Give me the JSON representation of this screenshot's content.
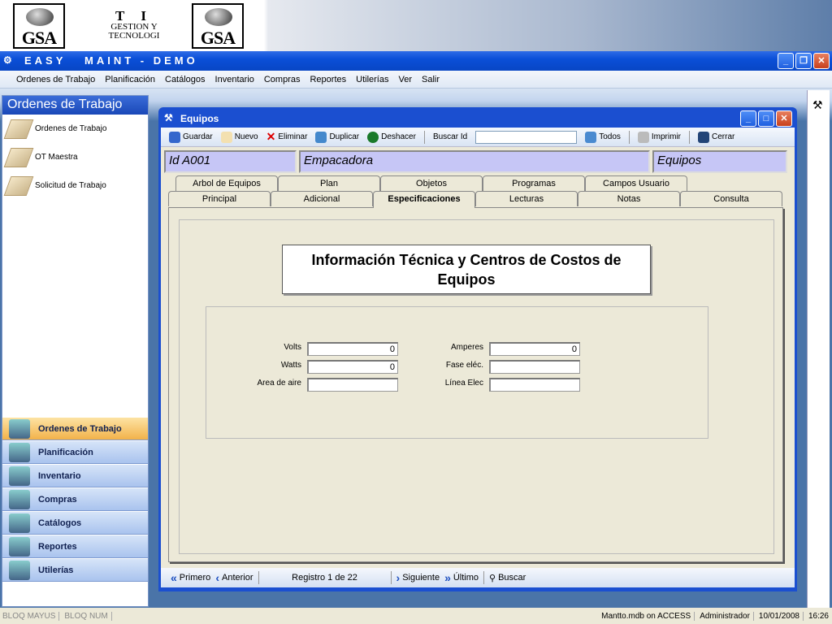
{
  "banner": {
    "logo1": "GSA",
    "logo2": "GSA",
    "ti": "T I",
    "ti_line2": "GESTION Y",
    "ti_line3": "TECNOLOGI"
  },
  "app": {
    "title": "EASY   MAINT - DEMO"
  },
  "menu": [
    "Ordenes de Trabajo",
    "Planificación",
    "Catálogos",
    "Inventario",
    "Compras",
    "Reportes",
    "Utilerías",
    "Ver",
    "Salir"
  ],
  "left": {
    "header": "Ordenes de Trabajo",
    "items": [
      "Ordenes de Trabajo",
      "OT Maestra",
      "Solicitud de Trabajo"
    ],
    "nav": [
      "Ordenes de Trabajo",
      "Planificación",
      "Inventario",
      "Compras",
      "Catálogos",
      "Reportes",
      "Utilerías"
    ]
  },
  "child": {
    "title": "Equipos",
    "toolbar": {
      "save": "Guardar",
      "new": "Nuevo",
      "delete": "Eliminar",
      "duplicate": "Duplicar",
      "undo": "Deshacer",
      "search_label": "Buscar Id",
      "search_value": "",
      "all": "Todos",
      "print": "Imprimir",
      "close": "Cerrar"
    },
    "info": {
      "id": "Id  A001",
      "name": "Empacadora",
      "type": "Equipos"
    },
    "tabs_row1": [
      "Arbol de Equipos",
      "Plan",
      "Objetos",
      "Programas",
      "Campos Usuario"
    ],
    "tabs_row2": [
      "Principal",
      "Adicional",
      "Especificaciones",
      "Lecturas",
      "Notas",
      "Consulta"
    ],
    "active_tab": "Especificaciones",
    "heading": "Información Técnica y Centros de Costos de Equipos",
    "fields": {
      "volts_label": "Volts",
      "volts": "0",
      "watts_label": "Watts",
      "watts": "0",
      "area_label": "Area de aire",
      "area": "",
      "amperes_label": "Amperes",
      "amperes": "0",
      "fase_label": "Fase eléc.",
      "fase": "",
      "linea_label": "Línea Elec",
      "linea": ""
    },
    "nav": {
      "first": "Primero",
      "prev": "Anterior",
      "record": "Registro 1 de 22",
      "next": "Siguiente",
      "last": "Último",
      "find": "Buscar"
    }
  },
  "status": {
    "caps": "BLOQ MAYUS",
    "num": "BLOQ NUM",
    "db": "Mantto.mdb on ACCESS",
    "user": "Administrador",
    "date": "10/01/2008",
    "time": "16:26"
  }
}
